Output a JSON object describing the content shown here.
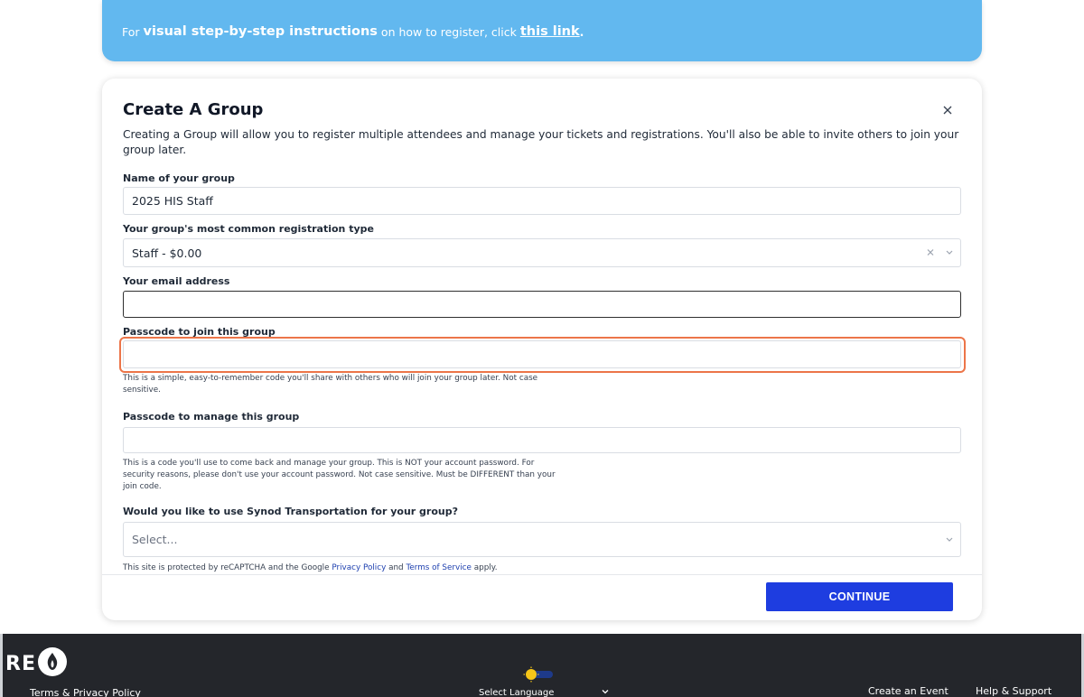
{
  "banner": {
    "prefix": "For",
    "bold_text": "visual step-by-step instructions",
    "middle": "on how to register, click",
    "link_text": "this link",
    "suffix": "."
  },
  "modal": {
    "title": "Create A Group",
    "description": "Creating a Group will allow you to register multiple attendees and manage your tickets and registrations. You'll also be able to invite others to join your group later.",
    "group_name": {
      "label": "Name of your group",
      "value": "2025 HIS Staff"
    },
    "reg_type": {
      "label": "Your group's most common registration type",
      "value": "Staff - $0.00"
    },
    "email": {
      "label": "Your email address",
      "value": ""
    },
    "join_passcode": {
      "label": "Passcode to join this group",
      "value": "",
      "help": "This is a simple, easy-to-remember code you'll share with others who will join your group later. Not case sensitive."
    },
    "manage_passcode": {
      "label": "Passcode to manage this group",
      "value": "",
      "help": "This is a code you'll use to come back and manage your group. This is NOT your account password. For security reasons, please don't use your account password. Not case sensitive. Must be DIFFERENT than your join code."
    },
    "transport": {
      "label": "Would you like to use Synod Transportation for your group?",
      "placeholder": "Select..."
    },
    "captcha": {
      "prefix": "This site is protected by reCAPTCHA and the Google",
      "privacy": "Privacy Policy",
      "and": "and",
      "terms": "Terms of Service",
      "suffix": "apply."
    },
    "continue_label": "CONTINUE"
  },
  "footer": {
    "brand_text": "RE",
    "terms_link": "Terms & Privacy Policy",
    "language": "Select Language",
    "create_event": "Create an Event",
    "help_support": "Help & Support"
  },
  "colors": {
    "banner": "#62b8ef",
    "accent": "#1e3de0",
    "highlight": "#ec7549",
    "footer": "#24262b"
  }
}
